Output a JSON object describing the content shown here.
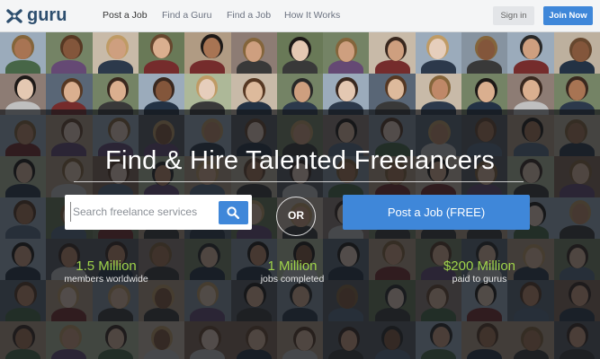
{
  "header": {
    "logo_text": "guru",
    "nav": [
      {
        "label": "Post a Job"
      },
      {
        "label": "Find a Guru"
      },
      {
        "label": "Find a Job"
      },
      {
        "label": "How It Works"
      }
    ],
    "signin_label": "Sign in",
    "join_label": "Join Now"
  },
  "hero": {
    "headline": "Find & Hire Talented Freelancers",
    "search_placeholder": "Search freelance services",
    "or_label": "OR",
    "post_job_label": "Post a Job (FREE)"
  },
  "stats": [
    {
      "value": "1.5 Million",
      "label": "members worldwide"
    },
    {
      "value": "1 Million",
      "label": "jobs completed"
    },
    {
      "value": "$200 Million",
      "label": "paid to gurus"
    }
  ],
  "colors": {
    "accent": "#3f87d9",
    "stat_green": "#9fd34a",
    "logo": "#2d4e6e"
  }
}
